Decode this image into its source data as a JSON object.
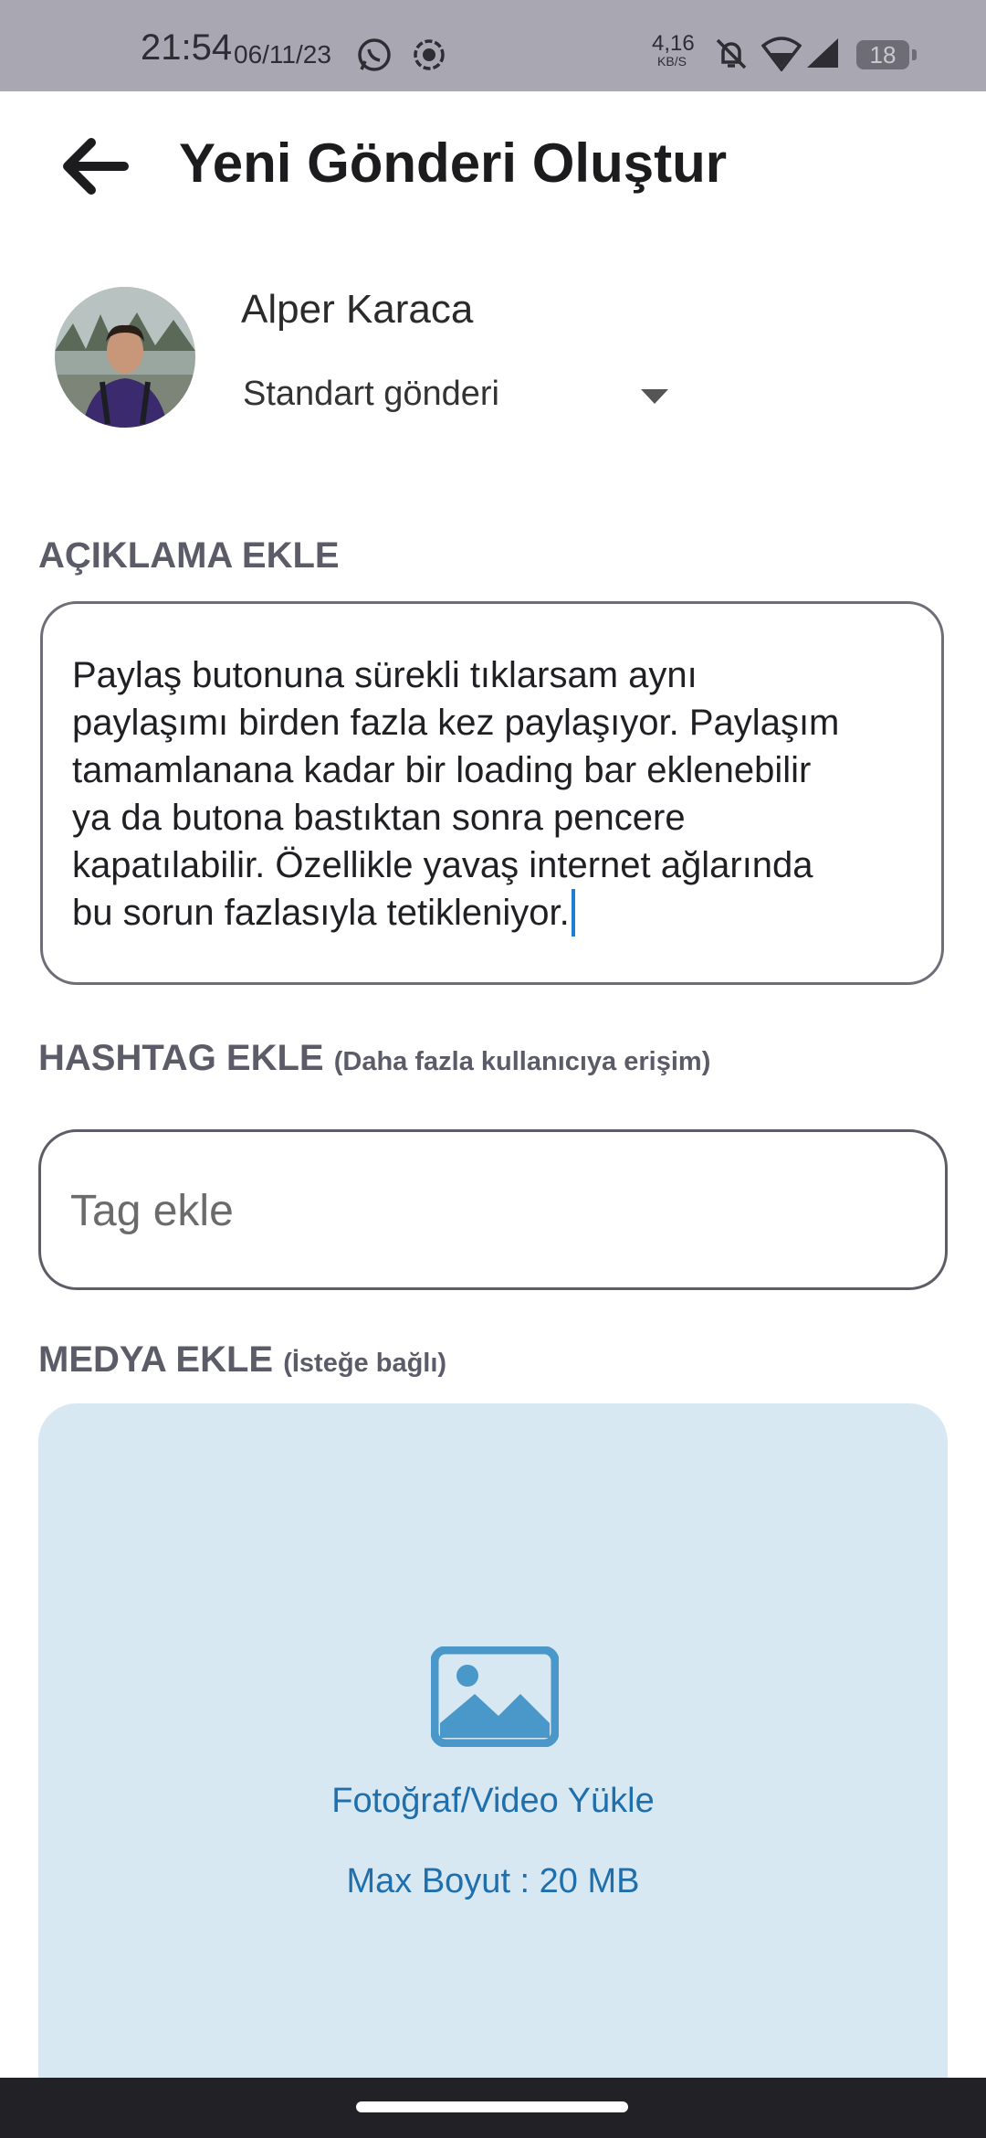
{
  "status_bar": {
    "time": "21:54",
    "date": "06/11/23",
    "net_speed_value": "4,16",
    "net_speed_unit": "KB/S",
    "battery": "18"
  },
  "header": {
    "title": "Yeni Gönderi Oluştur",
    "back_icon": "arrow-left-icon"
  },
  "user": {
    "name": "Alper Karaca",
    "post_type": "Standart gönderi"
  },
  "description": {
    "label": "AÇIKLAMA EKLE",
    "text": "Paylaş butonuna sürekli tıklarsam aynı\npaylaşımı birden fazla kez paylaşıyor. Paylaşım\ntamamlanana kadar bir loading bar eklenebilir\nya da butona bastıktan sonra pencere\nkapatılabilir. Özellikle yavaş internet ağlarında\nbu sorun fazlasıyla tetikleniyor."
  },
  "hashtag": {
    "label": "HASHTAG EKLE",
    "sublabel": "(Daha fazla kullanıcıya erişim)",
    "placeholder": "Tag ekle"
  },
  "media": {
    "label": "MEDYA EKLE",
    "sublabel": "(İsteğe bağlı)",
    "upload_text": "Fotoğraf/Video Yükle",
    "max_size_text": "Max Boyut : 20 MB",
    "icon": "image-icon"
  },
  "colors": {
    "accent": "#1f6fad",
    "media_bg": "#d8e8f2",
    "caret": "#1e7ed4",
    "status_bar": "#a9a8b2"
  }
}
